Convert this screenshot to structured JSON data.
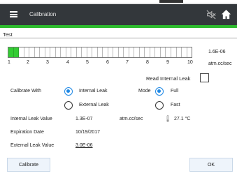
{
  "header": {
    "title": "Calibration",
    "menu_icon": "hamburger-icon",
    "mute_icon": "speaker-muted-icon",
    "home_icon": "home-icon"
  },
  "section": {
    "label": "Test"
  },
  "progress": {
    "total_segments": 35,
    "filled_segments": 2,
    "fill_color": "#33cc33",
    "ticks": [
      "1",
      "2",
      "3",
      "4",
      "5",
      "6",
      "7",
      "8",
      "9",
      "10"
    ],
    "leak_value": "1.6E-06",
    "leak_unit": "atm.cc/sec"
  },
  "read_internal_leak": {
    "label": "Read Internal Leak",
    "checked": false
  },
  "calibrate_with": {
    "label": "Calibrate With",
    "options": [
      "Internal Leak",
      "External Leak"
    ],
    "selected": "Internal Leak"
  },
  "mode": {
    "label": "Mode",
    "options": [
      "Full",
      "Fast"
    ],
    "selected": "Full"
  },
  "internal_leak": {
    "label": "Internal Leak Value",
    "value": "1.3E-07",
    "unit": "atm.cc/sec",
    "temperature": "27.1 °C"
  },
  "expiration": {
    "label": "Expiration Date",
    "value": "10/19/2017"
  },
  "external_leak": {
    "label": "External Leak Value",
    "value": "3.0E-06"
  },
  "buttons": {
    "calibrate": "Calibrate",
    "ok": "OK"
  },
  "colors": {
    "header_bg": "#33373b",
    "accent_green": "#2dbb2d",
    "radio_blue": "#1e88e5"
  }
}
